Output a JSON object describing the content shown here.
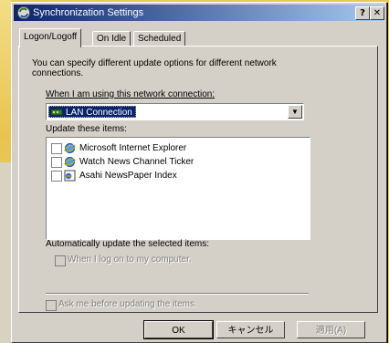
{
  "window": {
    "title": "Synchronization Settings",
    "help_glyph": "?",
    "close_glyph": "✕"
  },
  "tabs": [
    {
      "label": "Logon/Logoff"
    },
    {
      "label": "On Idle"
    },
    {
      "label": "Scheduled"
    }
  ],
  "intro": {
    "line1": "You can specify different update options for different network",
    "line2": "connections."
  },
  "connection": {
    "label": "When I am using this network connection:",
    "value": "LAN Connection"
  },
  "items": {
    "label": "Update these items:",
    "list": [
      {
        "label": "Microsoft Internet Explorer",
        "checked": false
      },
      {
        "label": "Watch News Channel Ticker",
        "checked": false
      },
      {
        "label": "Asahi NewsPaper Index",
        "checked": false
      }
    ]
  },
  "auto_update": {
    "label": "Automatically update the selected items:",
    "when_logon": "When I log on to my computer."
  },
  "ask_before": "Ask me before updating the items.",
  "buttons": {
    "ok": "OK",
    "cancel": "キャンセル",
    "apply": "適用(A)"
  },
  "colors": {
    "titlebar_start": "#0a246a",
    "titlebar_end": "#a6caf0",
    "face": "#d4d0c8",
    "desktop": "#e9c85a"
  }
}
